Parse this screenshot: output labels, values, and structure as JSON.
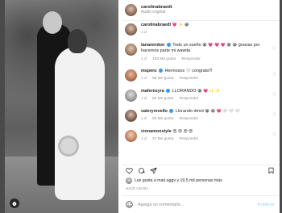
{
  "post": {
    "username": "carolinabraedt",
    "audio": "Audio original"
  },
  "comments": [
    {
      "username": "carolinabraedt",
      "verified": false,
      "text": "",
      "emojis": "💗 ✨ 😭",
      "time": "1 d",
      "likes": "",
      "reply": ""
    },
    {
      "username": "tanarendon",
      "verified": true,
      "text": "Todo un sueño",
      "emojis": "😭 💗 💗 💗 😭 😭",
      "text2": "gracias por hacernos parte mi wawita",
      "time": "1 d",
      "likes": "193 Me gusta",
      "reply": "Responder"
    },
    {
      "username": "msperu",
      "verified": true,
      "text": "Hermosos",
      "emojis": "🤍",
      "text2": "congrats!!!",
      "time": "1 d",
      "likes": "58 Me gusta",
      "reply": "Responder"
    },
    {
      "username": "mafernzyra",
      "verified": true,
      "text": "LLORANDO",
      "emojis": "😭 💗 ✨ ✨",
      "text2": "",
      "time": "1 d",
      "likes": "56 Me gusta",
      "reply": "Responder"
    },
    {
      "username": "valeryrevello",
      "verified": true,
      "text": "Llorando dmrd",
      "emojis": "😭 😭 💗 🤍 🤍 🤍",
      "text2": "",
      "time": "1 d",
      "likes": "55 Me gusta",
      "reply": "Responder"
    },
    {
      "username": "cinnamonstyle",
      "verified": false,
      "text": "",
      "emojis": "😍 😍 😍 😍",
      "text2": "",
      "time": "1 d",
      "likes": "37 Me gusta",
      "reply": "Responder"
    }
  ],
  "likes_text": "Les gusta a mari.aggv y 19,5 mil personas más",
  "time_ago": "Hace un día",
  "add_comment": {
    "placeholder": "Agrega un comentario...",
    "publish": "Publicar"
  },
  "icons": {
    "heart": "heart-icon",
    "comment": "comment-icon",
    "share": "share-icon",
    "save": "bookmark-icon",
    "emoji": "emoji-icon",
    "user_tag": "user-tag-icon"
  }
}
